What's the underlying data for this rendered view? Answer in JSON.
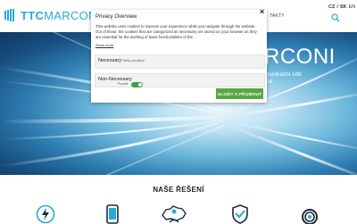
{
  "header": {
    "logo_ttc": "TTC",
    "logo_marconi": "MARCONI",
    "nav_partial": "TAKTY",
    "languages": [
      "CZ",
      "SK",
      "EN",
      "RU"
    ]
  },
  "hero": {
    "title": "RCONI",
    "line1": "komunikační sítě",
    "line2": "erace"
  },
  "modal": {
    "title": "Privacy Overview",
    "text": "This website uses cookies to improve your experience while you navigate through the website. Out of these, the cookies that are categorized as necessary are stored on your browser as they are essential for the working of basic functionalities of the ...",
    "show_more": "Show more",
    "rows": [
      {
        "label": "Necessary",
        "status": "Vždy povoleno"
      },
      {
        "label": "Non-Necessary",
        "status": "Povolit"
      }
    ],
    "save_button": "ULOŽIT A PŘIJMOUT",
    "toggle_color": "#3ea047"
  },
  "section": {
    "title": "NAŠE ŘEŠENÍ",
    "icons": [
      "lightning-icon",
      "phone-icon",
      "czech-map-icon",
      "shield-check-icon",
      "signal-icon"
    ]
  },
  "colors": {
    "brand": "#2aa8d8",
    "button": "#58a743",
    "icon_accent": "#2aa8d8"
  }
}
